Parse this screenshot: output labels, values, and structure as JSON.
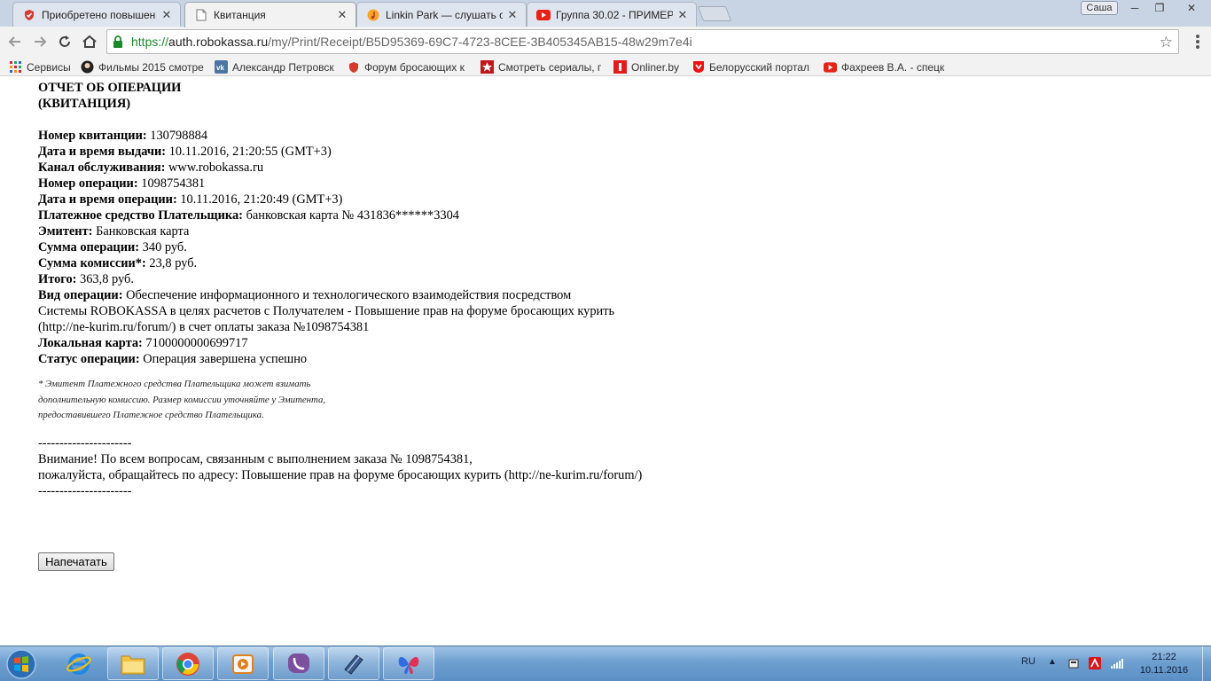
{
  "tabs": [
    {
      "title": "Приобретено повышен",
      "active": false
    },
    {
      "title": "Квитанция",
      "active": true
    },
    {
      "title": "Linkin Park — слушать о",
      "active": false
    },
    {
      "title": "Группа 30.02 - ПРИМЕР",
      "active": false
    }
  ],
  "window": {
    "user": "Саша"
  },
  "address": {
    "https": "https://",
    "host": "auth.robokassa.ru",
    "path": "/my/Print/Receipt/B5D95369-69C7-4723-8CEE-3B405345AB15-48w29m7e4i"
  },
  "bookmarks": [
    {
      "label": "Сервисы",
      "icon": "apps-grid-icon"
    },
    {
      "label": "Фильмы 2015 смотре",
      "icon": "avatar-icon"
    },
    {
      "label": "Александр Петровск",
      "icon": "vk-icon"
    },
    {
      "label": "Форум бросающих к",
      "icon": "shield-icon"
    },
    {
      "label": "Смотреть сериалы, п",
      "icon": "star-icon"
    },
    {
      "label": "Onliner.by",
      "icon": "onliner-icon"
    },
    {
      "label": "Белорусский портал",
      "icon": "tut-icon"
    },
    {
      "label": "Фахреев В.А. - спецк",
      "icon": "youtube-icon"
    }
  ],
  "receipt": {
    "heading_line1": "ОТЧЕТ ОБ ОПЕРАЦИИ",
    "heading_line2": "(КВИТАНЦИЯ)",
    "rows": [
      {
        "label": "Номер квитанции:",
        "value": " 130798884"
      },
      {
        "label": "Дата и время выдачи:",
        "value": " 10.11.2016, 21:20:55 (GMT+3)"
      },
      {
        "label": "Канал обслуживания:",
        "value": " www.robokassa.ru"
      },
      {
        "label": "Номер операции:",
        "value": " 1098754381"
      },
      {
        "label": "Дата и время операции:",
        "value": " 10.11.2016, 21:20:49 (GMT+3)"
      },
      {
        "label": "Платежное средство Плательщика:",
        "value": " банковская карта № 431836******3304"
      },
      {
        "label": "Эмитент:",
        "value": " Банковская карта"
      },
      {
        "label": "Сумма операции:",
        "value": " 340 руб."
      },
      {
        "label": "Сумма комиссии*:",
        "value": " 23,8 руб."
      },
      {
        "label": "Итого:",
        "value": " 363,8 руб."
      },
      {
        "label": "Вид операции:",
        "value": " Обеспечение информационного и технологического взаимодействия посредством"
      }
    ],
    "operation_line2": "Системы ROBOKASSA в целях расчетов с Получателем - Повышение прав на форуме бросающих курить",
    "operation_line3": "(http://ne-kurim.ru/forum/) в счет оплаты заказа №1098754381",
    "rows_after": [
      {
        "label": "Локальная карта:",
        "value": " 7100000000699717"
      },
      {
        "label": "Статус операции:",
        "value": " Операция завершена успешно"
      }
    ],
    "note_line1": "* Эмитент Платежного средства Плательщика может взимать",
    "note_line2": "дополнительную комиссию. Размер комиссии уточняйте у Эмитента,",
    "note_line3": "предоставившего Платежное средство Плательщика.",
    "divider": "----------------------",
    "attention_line1": "Внимание! По всем вопросам, связанным с выполнением заказа № 1098754381,",
    "attention_line2": "пожалуйста, обращайтесь по адресу: Повышение прав на форуме бросающих курить (http://ne-kurim.ru/forum/)",
    "print_button": "Напечатать"
  },
  "taskbar": {
    "language": "RU",
    "time": "21:22",
    "date": "10.11.2016"
  }
}
